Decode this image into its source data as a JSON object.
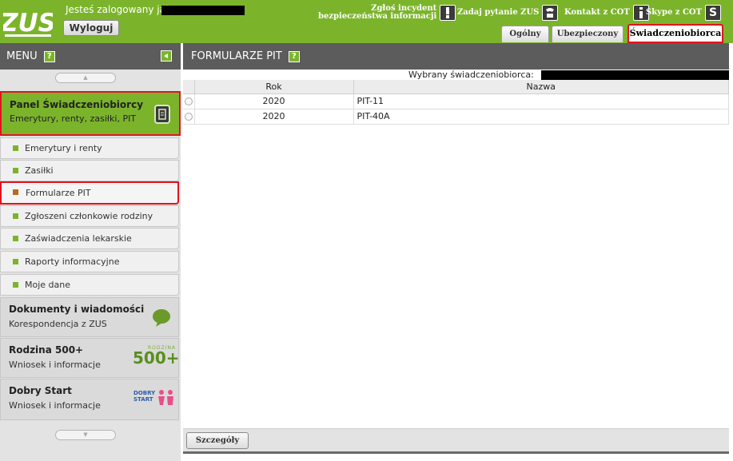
{
  "header": {
    "logo_text": "ZUS",
    "logged_in_label": "Jesteś zalogowany jako:",
    "logout_label": "Wyloguj",
    "links": {
      "incident_line1": "Zgłoś incydent",
      "incident_line2": "bezpieczeństwa informacji",
      "question": "Zadaj pytanie ZUS",
      "cot": "Kontakt z COT",
      "skype": "Skype z COT"
    },
    "tabs": [
      "Ogólny",
      "Ubezpieczony",
      "Świadczeniobiorca"
    ],
    "active_tab": "Świadczeniobiorca"
  },
  "menu": {
    "title": "MENU",
    "help": "?",
    "panel": {
      "title": "Panel Świadczeniobiorcy",
      "subtitle": "Emerytury, renty, zasiłki, PIT"
    },
    "sub_items": [
      "Emerytury i renty",
      "Zasiłki",
      "Formularze PIT",
      "Zgłoszeni członkowie rodziny",
      "Zaświadczenia lekarskie",
      "Raporty informacyjne",
      "Moje dane"
    ],
    "active_item": "Formularze PIT",
    "sections": [
      {
        "title": "Dokumenty i wiadomości",
        "subtitle": "Korespondencja z ZUS"
      },
      {
        "title": "Rodzina 500+",
        "subtitle": "Wniosek i informacje",
        "badge_small": "RODZINA",
        "badge_big": "500+"
      },
      {
        "title": "Dobry Start",
        "subtitle": "Wniosek i informacje",
        "badge": "DOBRY START"
      }
    ]
  },
  "main": {
    "title": "FORMULARZE PIT",
    "help": "?",
    "selected_label": "Wybrany świadczeniobiorca:",
    "columns": [
      "Rok",
      "Nazwa"
    ],
    "rows": [
      {
        "year": "2020",
        "name": "PIT-11"
      },
      {
        "year": "2020",
        "name": "PIT-40A"
      }
    ],
    "details_button": "Szczegóły"
  },
  "colors": {
    "brand_green": "#7bb42b",
    "header_gray": "#5c5c5c",
    "highlight_red": "#e0141e"
  }
}
